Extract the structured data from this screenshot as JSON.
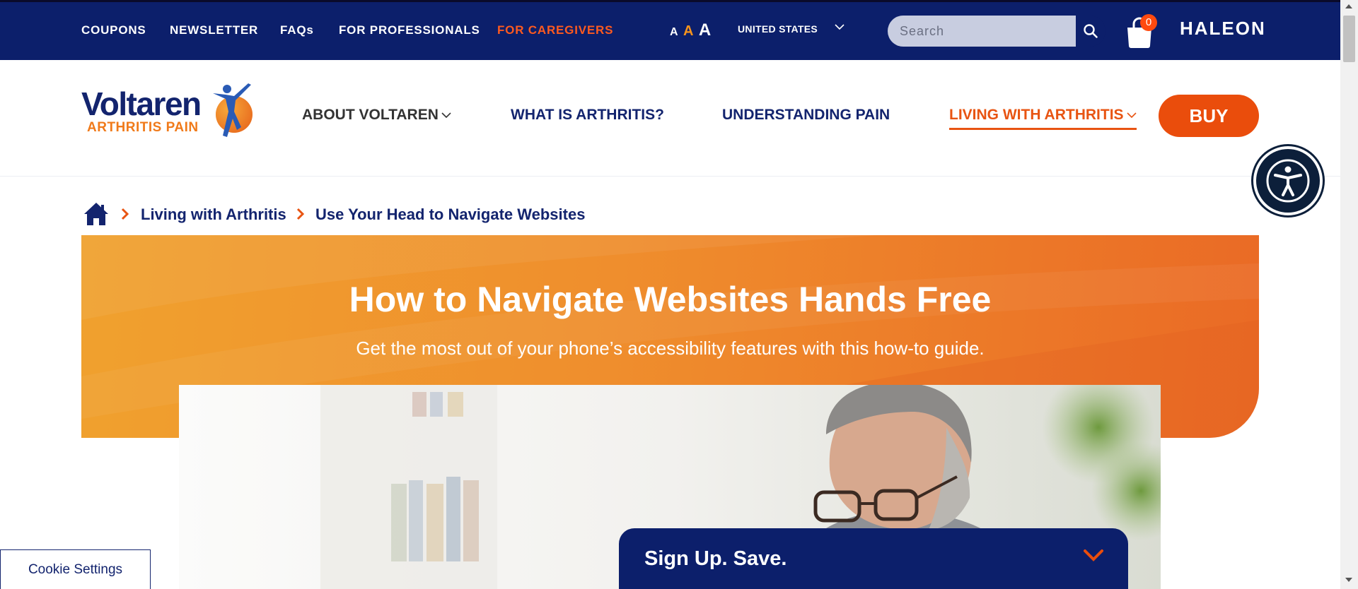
{
  "topbar": {
    "links": [
      "COUPONS",
      "NEWSLETTER",
      "FAQs",
      "FOR PROFESSIONALS",
      "FOR CAREGIVERS"
    ],
    "font_size_labels": [
      "A",
      "A",
      "A"
    ],
    "country": "UNITED STATES",
    "search_placeholder": "Search",
    "cart_count": "0",
    "brand": "HALEON"
  },
  "logo": {
    "name": "Voltaren",
    "subtitle": "ARTHRITIS PAIN"
  },
  "nav": {
    "items": [
      "ABOUT VOLTAREN",
      "WHAT IS ARTHRITIS?",
      "UNDERSTANDING PAIN",
      "LIVING WITH ARTHRITIS"
    ],
    "buy_label": "BUY"
  },
  "breadcrumb": {
    "items": [
      "Living with Arthritis",
      "Use Your Head to Navigate Websites"
    ]
  },
  "hero": {
    "title": "How to Navigate Websites Hands Free",
    "subtitle": "Get the most out of your phone’s accessibility features with this how-to guide."
  },
  "signup": {
    "title": "Sign Up. Save."
  },
  "cookie": {
    "label": "Cookie Settings"
  },
  "colors": {
    "navy": "#0c1f6b",
    "orange": "#ea4d0c",
    "hero_orange": "#ef8e2d"
  }
}
